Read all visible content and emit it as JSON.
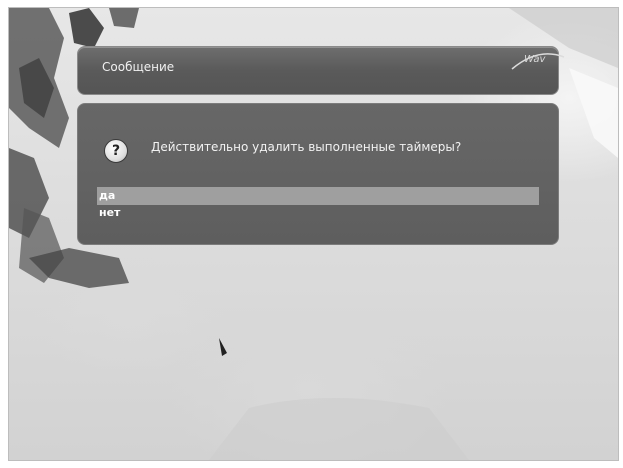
{
  "window": {
    "title": "Сообщение",
    "logo_text": "Wav"
  },
  "dialog": {
    "icon": "question-icon",
    "icon_glyph": "?",
    "message": "Действительно удалить выполненные таймеры?",
    "options": [
      {
        "label": "да",
        "selected": true
      },
      {
        "label": "нет",
        "selected": false
      }
    ]
  },
  "colors": {
    "titlebar": "#5a5a5a",
    "dialog": "#5e5e5e",
    "selection": "#9f9f9f",
    "text": "#ffffff"
  }
}
